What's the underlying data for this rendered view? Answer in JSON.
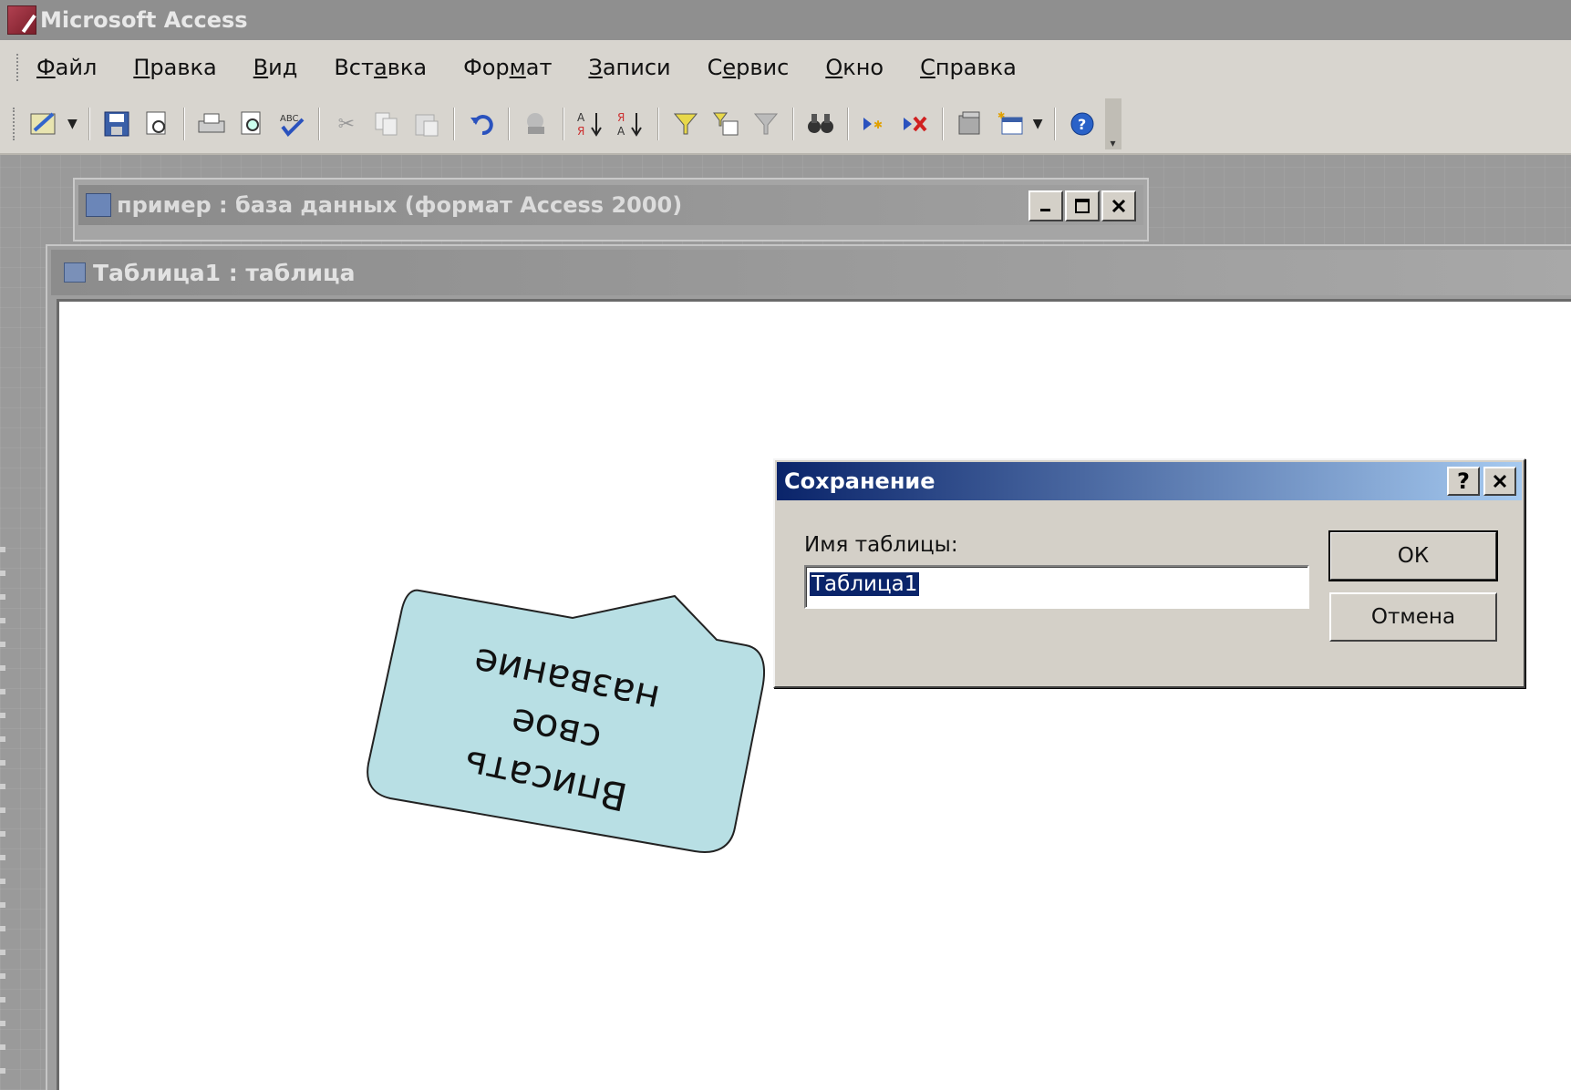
{
  "app": {
    "title": "Microsoft Access"
  },
  "menu": [
    {
      "prefix": "",
      "underline": "Ф",
      "rest": "айл"
    },
    {
      "prefix": "",
      "underline": "П",
      "rest": "равка"
    },
    {
      "prefix": "",
      "underline": "В",
      "rest": "ид"
    },
    {
      "prefix": "Вст",
      "underline": "а",
      "rest": "вка"
    },
    {
      "prefix": "Фор",
      "underline": "м",
      "rest": "ат"
    },
    {
      "prefix": "",
      "underline": "З",
      "rest": "аписи"
    },
    {
      "prefix": "С",
      "underline": "е",
      "rest": "рвис"
    },
    {
      "prefix": "",
      "underline": "О",
      "rest": "кно"
    },
    {
      "prefix": "",
      "underline": "С",
      "rest": "правка"
    }
  ],
  "db_window": {
    "title": "пример : база данных (формат Access 2000)"
  },
  "table_window": {
    "title": "Таблица1 : таблица"
  },
  "dialog": {
    "title": "Сохранение",
    "help": "?",
    "close": "✕",
    "label": "Имя таблицы:",
    "value": "Таблица1",
    "ok": "ОК",
    "cancel": "Отмена"
  },
  "callout": {
    "text": "Вписать свое название",
    "lines": [
      "Вписать",
      "свое",
      "название"
    ]
  },
  "colors": {
    "dialog_title_start": "#0a246a",
    "dialog_title_end": "#a6caf0",
    "callout_fill": "#b8dfe4"
  }
}
